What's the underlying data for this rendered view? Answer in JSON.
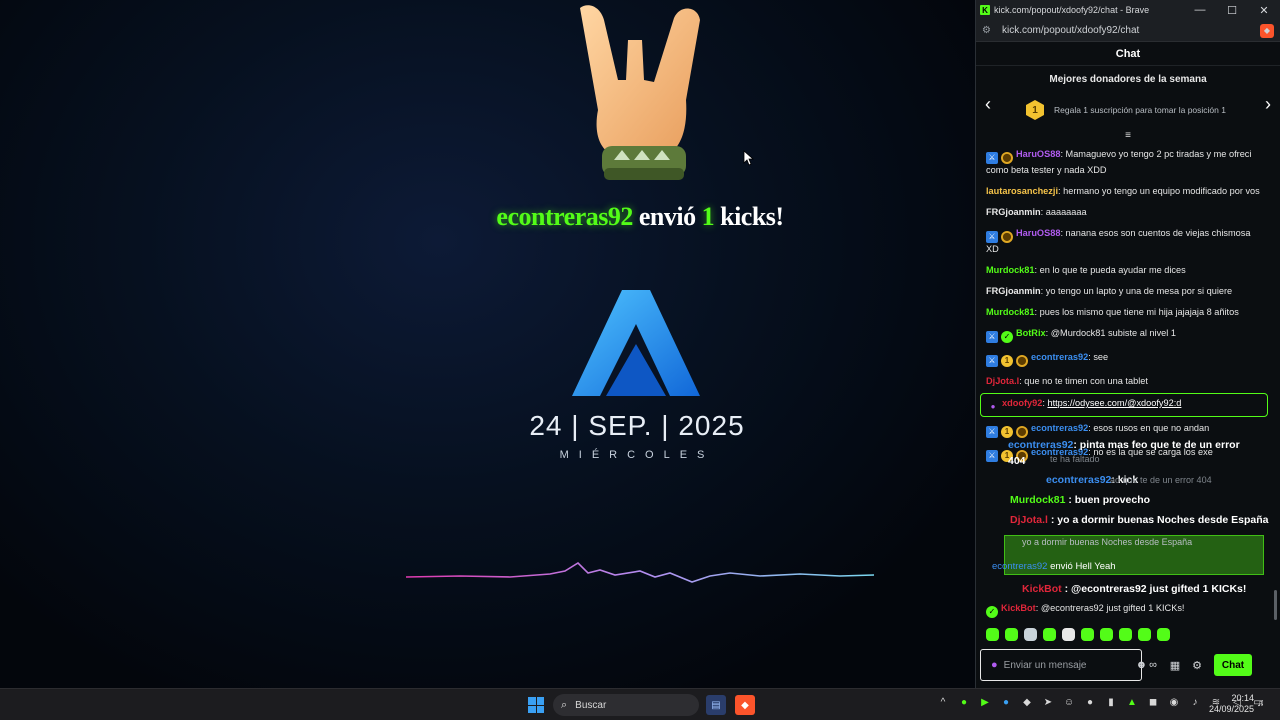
{
  "stream": {
    "alert": {
      "name": "econtreras92",
      "text1": "envió",
      "amount": "1",
      "text2": "kicks!"
    },
    "date": "24 | SEP. | 2025",
    "weekday": "MIÉRCOLES"
  },
  "window": {
    "title": "kick.com/popout/xdoofy92/chat - Brave",
    "url": "kick.com/popout/xdoofy92/chat",
    "minimize": "—",
    "maximize": "☐",
    "close": "✕"
  },
  "chat": {
    "header": "Chat",
    "donors_title": "Mejores donadores de la semana",
    "donors_rank": "1",
    "donors_text": "Regala 1 suscripción para tomar la posición 1",
    "messages": [
      {
        "user": "HaruOS88",
        "color": "#b15cf0",
        "badges": [
          "mod",
          "coin"
        ],
        "text": "Mamaguevo yo tengo 2 pc tiradas y me ofreci como beta tester y nada XDD"
      },
      {
        "user": "lautarosanchezji",
        "color": "#f5c34a",
        "badges": [],
        "text": "hermano yo tengo un equipo modificado por vos"
      },
      {
        "user": "FRGjoanmin",
        "color": "#e8e8e8",
        "badges": [],
        "text": "aaaaaaaa"
      },
      {
        "user": "HaruOS88",
        "color": "#b15cf0",
        "badges": [
          "mod",
          "coin"
        ],
        "text": "nanana esos son cuentos de viejas chismosa XD"
      },
      {
        "user": "Murdock81",
        "color": "#53fc18",
        "badges": [],
        "text": "en lo que te pueda ayudar me dices"
      },
      {
        "user": "FRGjoanmin",
        "color": "#e8e8e8",
        "badges": [],
        "text": "yo tengo un lapto y una de mesa por si quiere"
      },
      {
        "user": "Murdock81",
        "color": "#53fc18",
        "badges": [],
        "text": "pues los mismo que tiene mi hija jajajaja 8 añitos"
      },
      {
        "user": "BotRix",
        "color": "#53fc18",
        "badges": [
          "mod",
          "bot"
        ],
        "text": "@Murdock81 subiste al nivel 1"
      },
      {
        "user": "econtreras92",
        "color": "#3b8ef0",
        "badges": [
          "mod",
          "sub",
          "coin"
        ],
        "text": "see"
      },
      {
        "user": "DjJota.l",
        "color": "#e0263a",
        "badges": [],
        "text": "que no te timen con una tablet"
      },
      {
        "user": "xdoofy92",
        "color": "#e0263a",
        "badges": [
          "mic"
        ],
        "text": "",
        "link": "https://odysee.com/@xdoofy92:d",
        "highlight": true
      },
      {
        "user": "econtreras92",
        "color": "#3b8ef0",
        "badges": [
          "mod",
          "sub",
          "coin"
        ],
        "text": "esos rusos en que no andan"
      },
      {
        "user": "econtreras92",
        "color": "#3b8ef0",
        "badges": [
          "mod",
          "sub",
          "coin"
        ],
        "text": "no es la que se carga los exe"
      }
    ],
    "overlay_lines": [
      {
        "user": "econtreras92",
        "text": ": pinta mas feo que te de un error 404"
      },
      {
        "user": "econtreras92",
        "text": ": kick"
      },
      {
        "user": "Murdock81",
        "text": " : buen provecho"
      },
      {
        "user": "DjJota.l",
        "text": " : yo a dormir buenas Noches desde España"
      },
      {
        "user": "KickBot",
        "text": " : @econtreras92 just gifted 1 KICKs!"
      }
    ],
    "faded": {
      "line1": "te ha faltado",
      "line2": "ao que te de un error 404",
      "line3": "yo a dormir buenas Noches desde España",
      "gift_user": "econtreras92",
      "gift_text": " envió Hell Yeah"
    },
    "last_message": {
      "user": "KickBot",
      "text": "@econtreras92 just gifted 1 KICKs!"
    },
    "input_placeholder": "Enviar un mensaje",
    "send_label": "Chat"
  },
  "taskbar": {
    "search_label": "Buscar",
    "time": "20:14",
    "date": "24/09/2025"
  },
  "colors": {
    "kick_green": "#53fc18",
    "mod_blue": "#2f7de1",
    "bg": "#0b0e11"
  }
}
